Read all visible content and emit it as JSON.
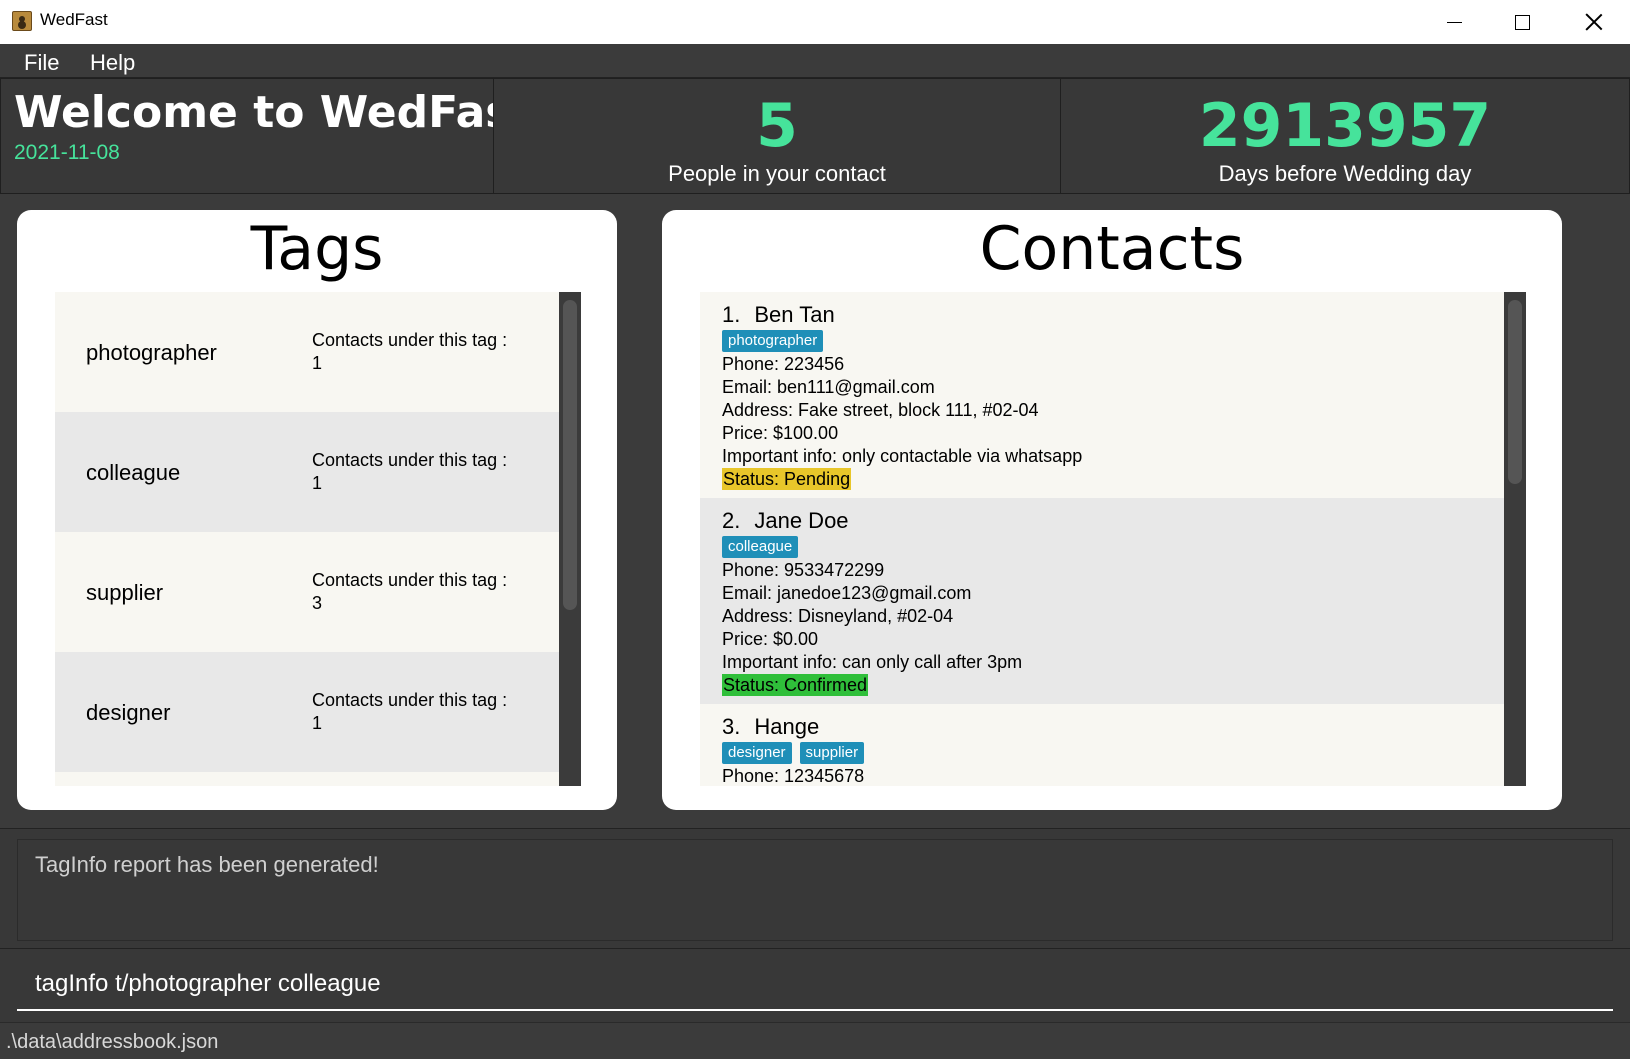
{
  "window": {
    "title": "WedFast"
  },
  "menu": {
    "file": "File",
    "help": "Help"
  },
  "header": {
    "welcome_title": "Welcome to WedFast!",
    "date": "2021-11-08",
    "contact_count": "5",
    "contact_caption": "People in your contact",
    "days_count": "2913957",
    "days_caption": "Days before Wedding day"
  },
  "tags_panel": {
    "title": "Tags",
    "count_label": "Contacts under this tag :",
    "items": [
      {
        "name": "photographer",
        "count": "1"
      },
      {
        "name": "colleague",
        "count": "1"
      },
      {
        "name": "supplier",
        "count": "3"
      },
      {
        "name": "designer",
        "count": "1"
      }
    ]
  },
  "contacts_panel": {
    "title": "Contacts",
    "items": [
      {
        "index": "1.",
        "name": "Ben Tan",
        "tags": [
          "photographer"
        ],
        "phone": "Phone: 223456",
        "email": "Email: ben111@gmail.com",
        "address": "Address: Fake street, block 111, #02-04",
        "price": "Price: $100.00",
        "info": "Important info: only contactable via whatsapp",
        "status": "Status: Pending"
      },
      {
        "index": "2.",
        "name": "Jane Doe",
        "tags": [
          "colleague"
        ],
        "phone": "Phone: 9533472299",
        "email": "Email: janedoe123@gmail.com",
        "address": "Address: Disneyland, #02-04",
        "price": "Price: $0.00",
        "info": "Important info: can only call after 3pm",
        "status": "Status: Confirmed"
      },
      {
        "index": "3.",
        "name": "Hange",
        "tags": [
          "designer",
          "supplier"
        ],
        "phone": "Phone: 12345678"
      }
    ]
  },
  "result": {
    "text": "TagInfo report has been generated!"
  },
  "command": {
    "value": "tagInfo t/photographer colleague"
  },
  "statusbar": {
    "path": ".\\data\\addressbook.json"
  },
  "colors": {
    "accent_green": "#46e39b",
    "tag_chip": "#1f8fb8",
    "status_pending": "#e8c62a",
    "status_confirmed": "#2fbf3a"
  }
}
